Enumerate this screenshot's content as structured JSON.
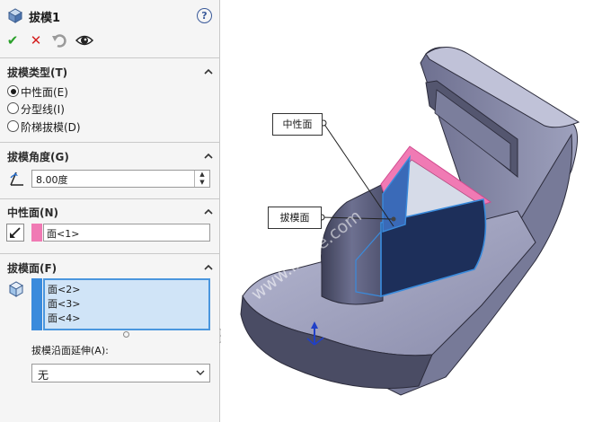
{
  "header": {
    "title": "拔模1",
    "help_glyph": "?"
  },
  "actions": {
    "ok": "✔",
    "cancel": "✕"
  },
  "draft_type": {
    "title": "拔模类型(T)",
    "options": [
      {
        "label": "中性面(E)",
        "selected": true
      },
      {
        "label": "分型线(I)",
        "selected": false
      },
      {
        "label": "阶梯拔模(D)",
        "selected": false
      }
    ]
  },
  "draft_angle": {
    "title": "拔模角度(G)",
    "value": "8.00度",
    "up": "▲",
    "down": "▼"
  },
  "neutral_plane": {
    "title": "中性面(N)",
    "value": "面<1>",
    "color": "#f07ab4"
  },
  "draft_faces": {
    "title": "拔模面(F)",
    "items": [
      "面<2>",
      "面<3>",
      "面<4>"
    ],
    "color": "#3a8bdc",
    "propagation_label": "拔模沿面延伸(A):",
    "propagation_value": "无"
  },
  "viewport": {
    "callout_neutral": "中性面",
    "callout_draft": "拔模面",
    "watermark": "www.ixage.com"
  }
}
